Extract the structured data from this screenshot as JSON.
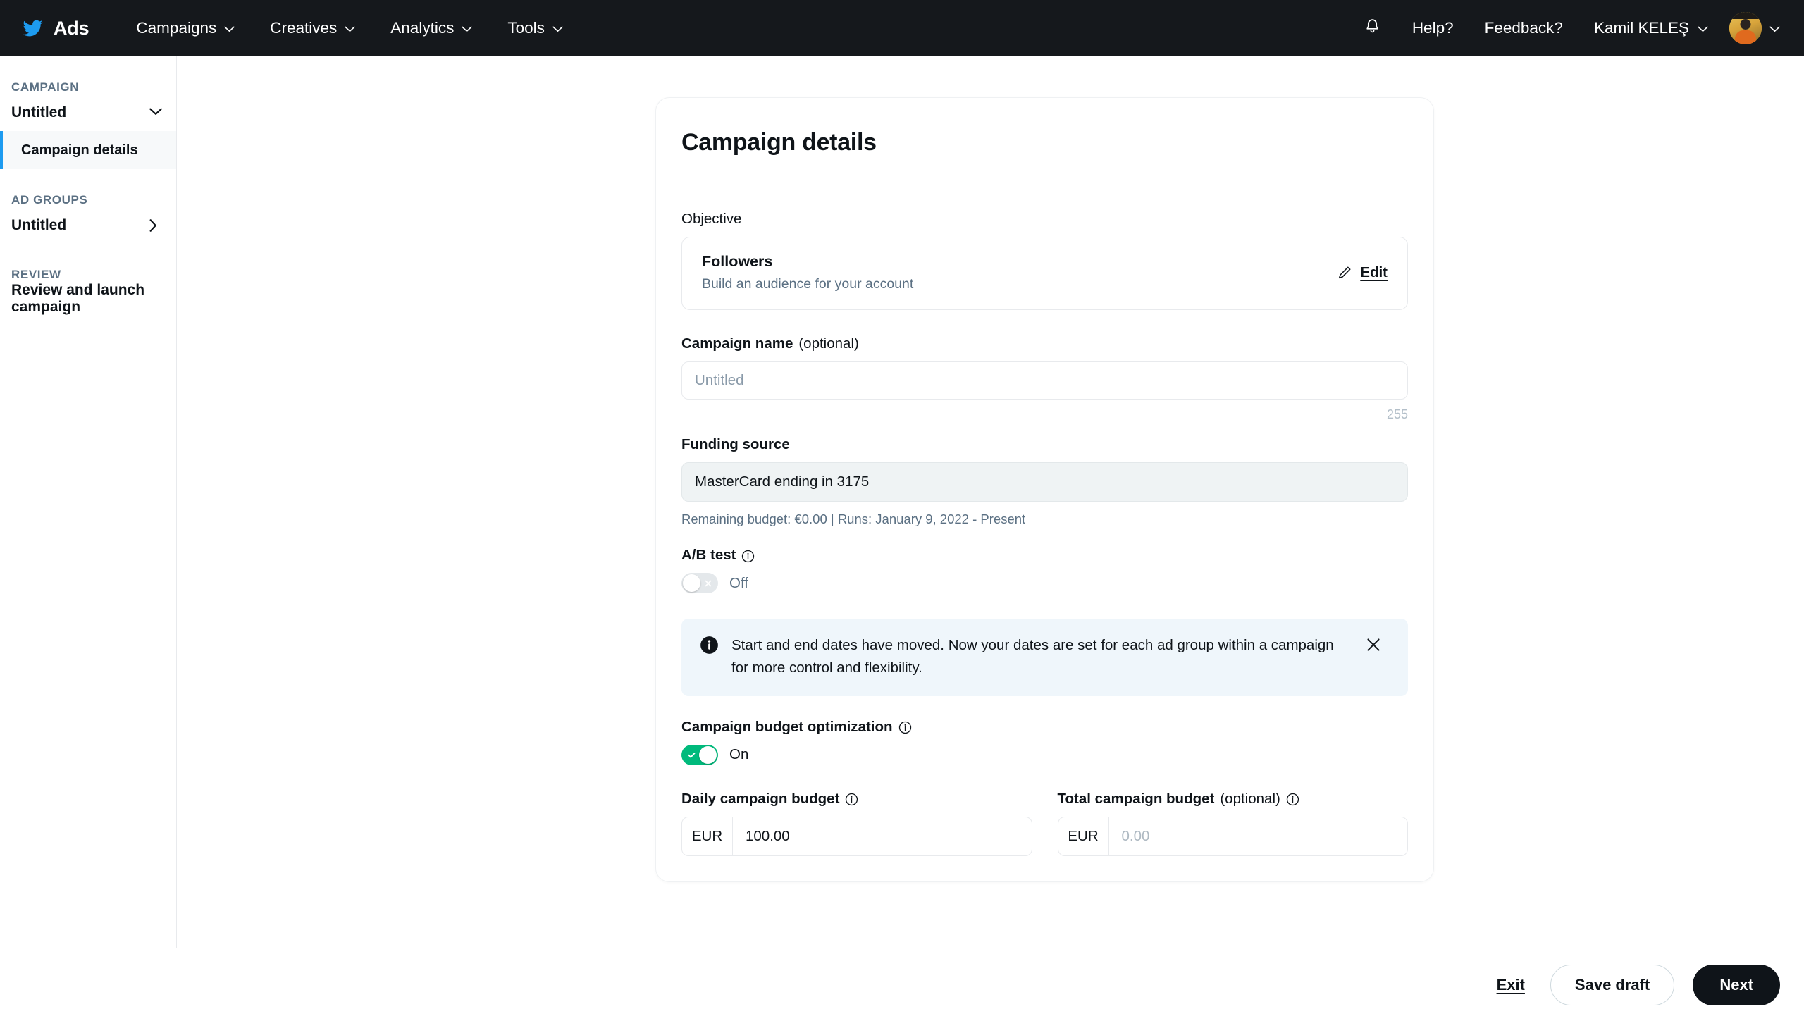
{
  "topnav": {
    "brand_icon": "twitter-bird-icon",
    "brand_label": "Ads",
    "menus": [
      {
        "label": "Campaigns"
      },
      {
        "label": "Creatives"
      },
      {
        "label": "Analytics"
      },
      {
        "label": "Tools"
      }
    ],
    "notifications_icon": "bell-icon",
    "help_label": "Help?",
    "feedback_label": "Feedback?",
    "account_name": "Kamil KELEŞ",
    "avatar": "user-avatar"
  },
  "sidebar": {
    "campaign_section_label": "CAMPAIGN",
    "campaign_name": "Untitled",
    "campaign_details_label": "Campaign details",
    "ad_groups_section_label": "AD GROUPS",
    "ad_group_name": "Untitled",
    "review_section_label": "REVIEW",
    "review_label": "Review and launch campaign"
  },
  "card": {
    "title": "Campaign details",
    "objective": {
      "label": "Objective",
      "name": "Followers",
      "description": "Build an audience for your account",
      "edit_label": "Edit"
    },
    "campaign_name": {
      "label_main": "Campaign name",
      "label_optional": "(optional)",
      "placeholder": "Untitled",
      "value": "",
      "char_count": "255"
    },
    "funding_source": {
      "label": "Funding source",
      "value": "MasterCard ending in 3175",
      "helper": "Remaining budget: €0.00 | Runs: January 9, 2022 - Present"
    },
    "ab_test": {
      "label": "A/B test",
      "state": "Off",
      "enabled": false
    },
    "banner": {
      "text": "Start and end dates have moved. Now your dates are set for each ad group within a campaign for more control and flexibility.",
      "icon": "info-circle-icon",
      "close_icon": "close-icon"
    },
    "budget_optimization": {
      "label": "Campaign budget optimization",
      "state": "On",
      "enabled": true
    },
    "daily_budget": {
      "label": "Daily campaign budget",
      "currency": "EUR",
      "value": "100.00",
      "placeholder": ""
    },
    "total_budget": {
      "label_main": "Total campaign budget",
      "label_optional": "(optional)",
      "currency": "EUR",
      "value": "",
      "placeholder": "0.00"
    }
  },
  "footer": {
    "exit_label": "Exit",
    "save_draft_label": "Save draft",
    "next_label": "Next"
  },
  "colors": {
    "nav_background": "#15181c",
    "twitter_blue": "#1d9bf0",
    "toggle_on_green": "#00ba7c",
    "banner_background": "#eff6fb",
    "primary_button": "#0f1419",
    "muted_text": "#5b7083"
  }
}
